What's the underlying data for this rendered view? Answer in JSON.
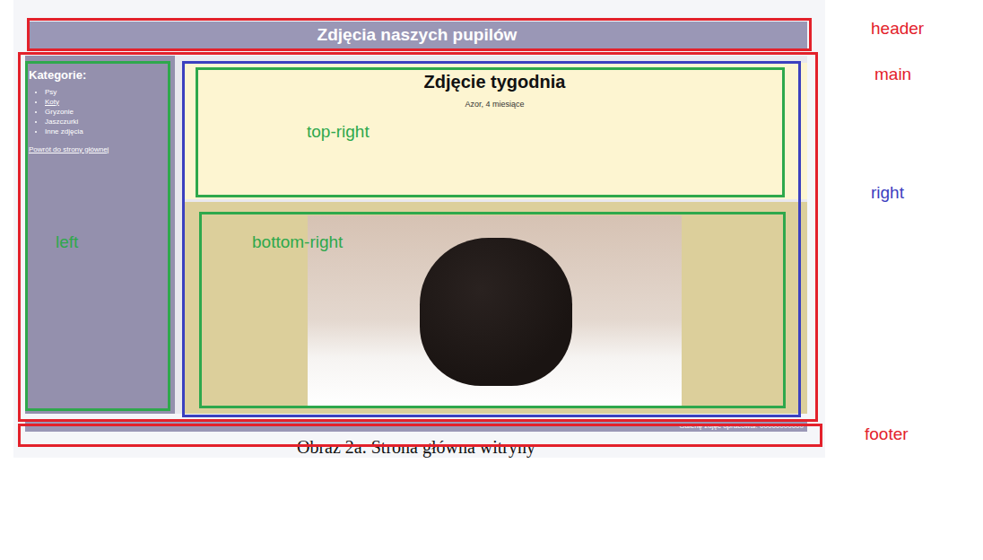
{
  "page": {
    "header": {
      "title": "Zdjęcia naszych pupilów"
    },
    "sidebar": {
      "heading": "Kategorie:",
      "items": [
        {
          "label": "Psy",
          "link": false
        },
        {
          "label": "Koty",
          "link": true
        },
        {
          "label": "Gryzonie",
          "link": false
        },
        {
          "label": "Jaszczurki",
          "link": false
        },
        {
          "label": "Inne zdjęcia",
          "link": false
        }
      ],
      "back_link": "Powrót do strony głównej"
    },
    "featured": {
      "title": "Zdjęcie tygodnia",
      "subtitle": "Azor, 4 miesiące"
    },
    "footer": {
      "text": "Galerię zdjęć opracował: 00000000000"
    },
    "figure_caption": "Obraz 2a. Strona główna witryny"
  },
  "annotations": [
    {
      "label": "header",
      "color": "#e3212b"
    },
    {
      "label": "main",
      "color": "#e3212b"
    },
    {
      "label": "right",
      "color": "#3b40bf"
    },
    {
      "label": "left",
      "color": "#2ea84c"
    },
    {
      "label": "top-right",
      "color": "#2ea84c"
    },
    {
      "label": "bottom-right",
      "color": "#2ea84c"
    },
    {
      "label": "footer",
      "color": "#e3212b"
    }
  ]
}
